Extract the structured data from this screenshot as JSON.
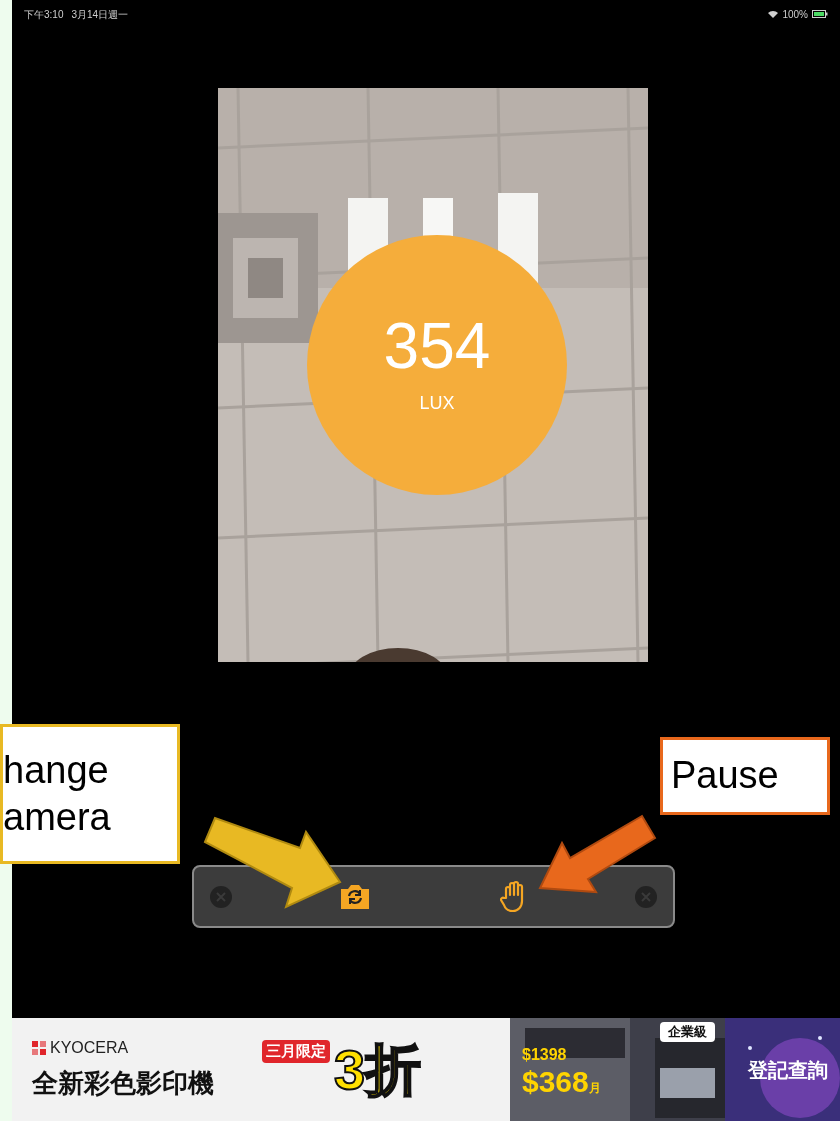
{
  "status_bar": {
    "time": "下午3:10",
    "date": "3月14日週一",
    "battery": "100%"
  },
  "meter": {
    "value": "354",
    "unit": "LUX"
  },
  "toolbar": {
    "buttons": [
      {
        "kind": "close"
      },
      {
        "kind": "switch-camera"
      },
      {
        "kind": "pause"
      },
      {
        "kind": "close"
      }
    ]
  },
  "callouts": [
    {
      "lines": [
        "hange",
        "amera"
      ],
      "color": "#e8b923"
    },
    {
      "lines": [
        "Pause"
      ],
      "color": "#e8681c"
    }
  ],
  "ad": {
    "brand": "KYOCERA",
    "headline": "全新彩色影印機",
    "tag": "三月限定",
    "discount": "3折",
    "old_price": "$1398",
    "price": "$368",
    "per": "月",
    "badge": "企業級",
    "cta": "登記查詢"
  }
}
